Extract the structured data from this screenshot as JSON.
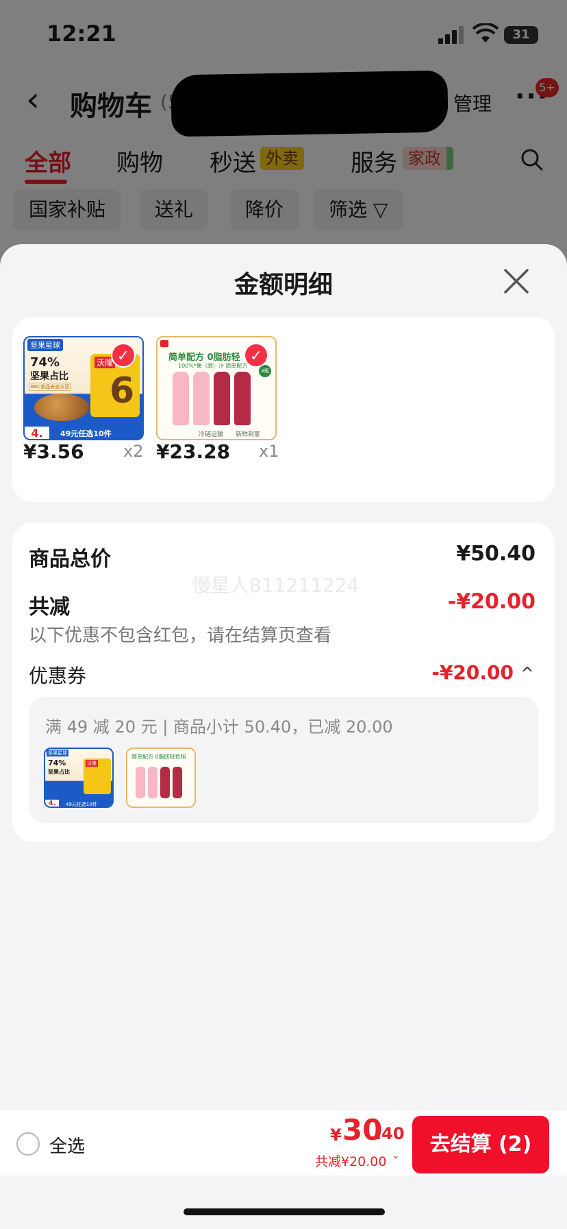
{
  "status_bar": {
    "time": "12:21",
    "battery": "31"
  },
  "nav": {
    "back": "‹",
    "title": "购物车",
    "count_open": "(5",
    "manage": "管理",
    "more": "···",
    "badge": "5+"
  },
  "tabs": [
    {
      "label": "全部"
    },
    {
      "label": "购物",
      "tag": ""
    },
    {
      "label": "秒送",
      "tag": "外卖"
    },
    {
      "label": "服务",
      "tag": "家政"
    }
  ],
  "chips": [
    "国家补贴",
    "送礼",
    "降价",
    "筛选 ▽"
  ],
  "sheet": {
    "title": "金额明细",
    "close": "✕",
    "products": [
      {
        "price": "¥3.56",
        "qty": "x2",
        "thumb": {
          "top_tag": "坚果星球",
          "pct": "74%",
          "line1": "坚果占比",
          "brand": "沃隆",
          "num": "6",
          "price_tag": "4.",
          "bottom": "49元任选10件",
          "cert": "BRC食品安全认证"
        }
      },
      {
        "price": "¥23.28",
        "qty": "x1",
        "thumb": {
          "headline": "简单配方 0脂肪轻",
          "sub": "100%*果（蔬）汁 简单配方",
          "cold": "冷链运输",
          "fresh": "新鲜到家",
          "tag": "4瓶"
        }
      }
    ],
    "total_label": "商品总价",
    "total_value": "¥50.40",
    "watermark": "慢星人811211224",
    "discount_label": "共减",
    "discount_value": "-¥20.00",
    "note": "以下优惠不包含红包，请在结算页查看",
    "coupon_label": "优惠券",
    "coupon_value": "-¥20.00",
    "coupon_caret": "^",
    "coupon_detail": "满 49 减 20 元 | 商品小计 50.40，已减 20.00",
    "mini_thumbs": [
      {
        "top_tag": "坚果星球",
        "pct": "74%",
        "line1": "坚果占比",
        "brand": "沃隆",
        "price_tag": "4.",
        "bottom": "49元任选10件"
      },
      {
        "headline": "简单配方 0脂肪轻负担"
      }
    ]
  },
  "footer": {
    "select_all": "全选",
    "currency": "¥",
    "total_int": "30",
    "total_dec": ".40",
    "saved": "共减¥20.00",
    "checkout": "去结算 (2)"
  },
  "colors": {
    "accent": "#e6222a",
    "button": "#f0102a",
    "sheet_bg": "#f4f4f6"
  }
}
